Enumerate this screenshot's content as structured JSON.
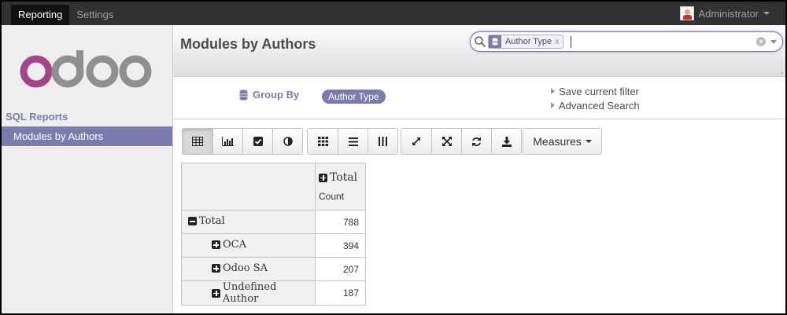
{
  "topbar": {
    "menu": [
      {
        "label": "Reporting",
        "active": true
      },
      {
        "label": "Settings",
        "active": false
      }
    ],
    "user_name": "Administrator"
  },
  "sidebar": {
    "logo_alt": "odoo",
    "section_title": "SQL Reports",
    "items": [
      {
        "label": "Modules by Authors",
        "active": true
      }
    ]
  },
  "control_panel": {
    "title": "Modules by Authors",
    "search": {
      "facet_value": "Author Type",
      "facet_remove": "x",
      "input_value": ""
    },
    "group_by": {
      "label": "Group By",
      "selected": "Author Type"
    },
    "links": {
      "save_filter": "Save current filter",
      "advanced_search": "Advanced Search"
    }
  },
  "toolbar": {
    "view_buttons": [
      "table-icon",
      "bar-chart-icon",
      "checkbox-icon",
      "contrast-icon"
    ],
    "expand_buttons": [
      "grid-icon",
      "list-icon",
      "columns-icon"
    ],
    "action_buttons": [
      "expand-arrows-icon",
      "fullscreen-icon",
      "refresh-icon",
      "download-icon"
    ],
    "measures_label": "Measures"
  },
  "pivot": {
    "column_header": "Total",
    "measure_header": "Count",
    "rows": [
      {
        "label": "Total",
        "value": "788",
        "level": 0,
        "expanded": true
      },
      {
        "label": "OCA",
        "value": "394",
        "level": 1,
        "expanded": false
      },
      {
        "label": "Odoo SA",
        "value": "207",
        "level": 1,
        "expanded": false
      },
      {
        "label": "Undefined Author",
        "value": "187",
        "level": 1,
        "expanded": false
      }
    ]
  },
  "colors": {
    "accent": "#7c7bad",
    "topbar": "#323232",
    "sidebar_bg": "#efeeef"
  }
}
